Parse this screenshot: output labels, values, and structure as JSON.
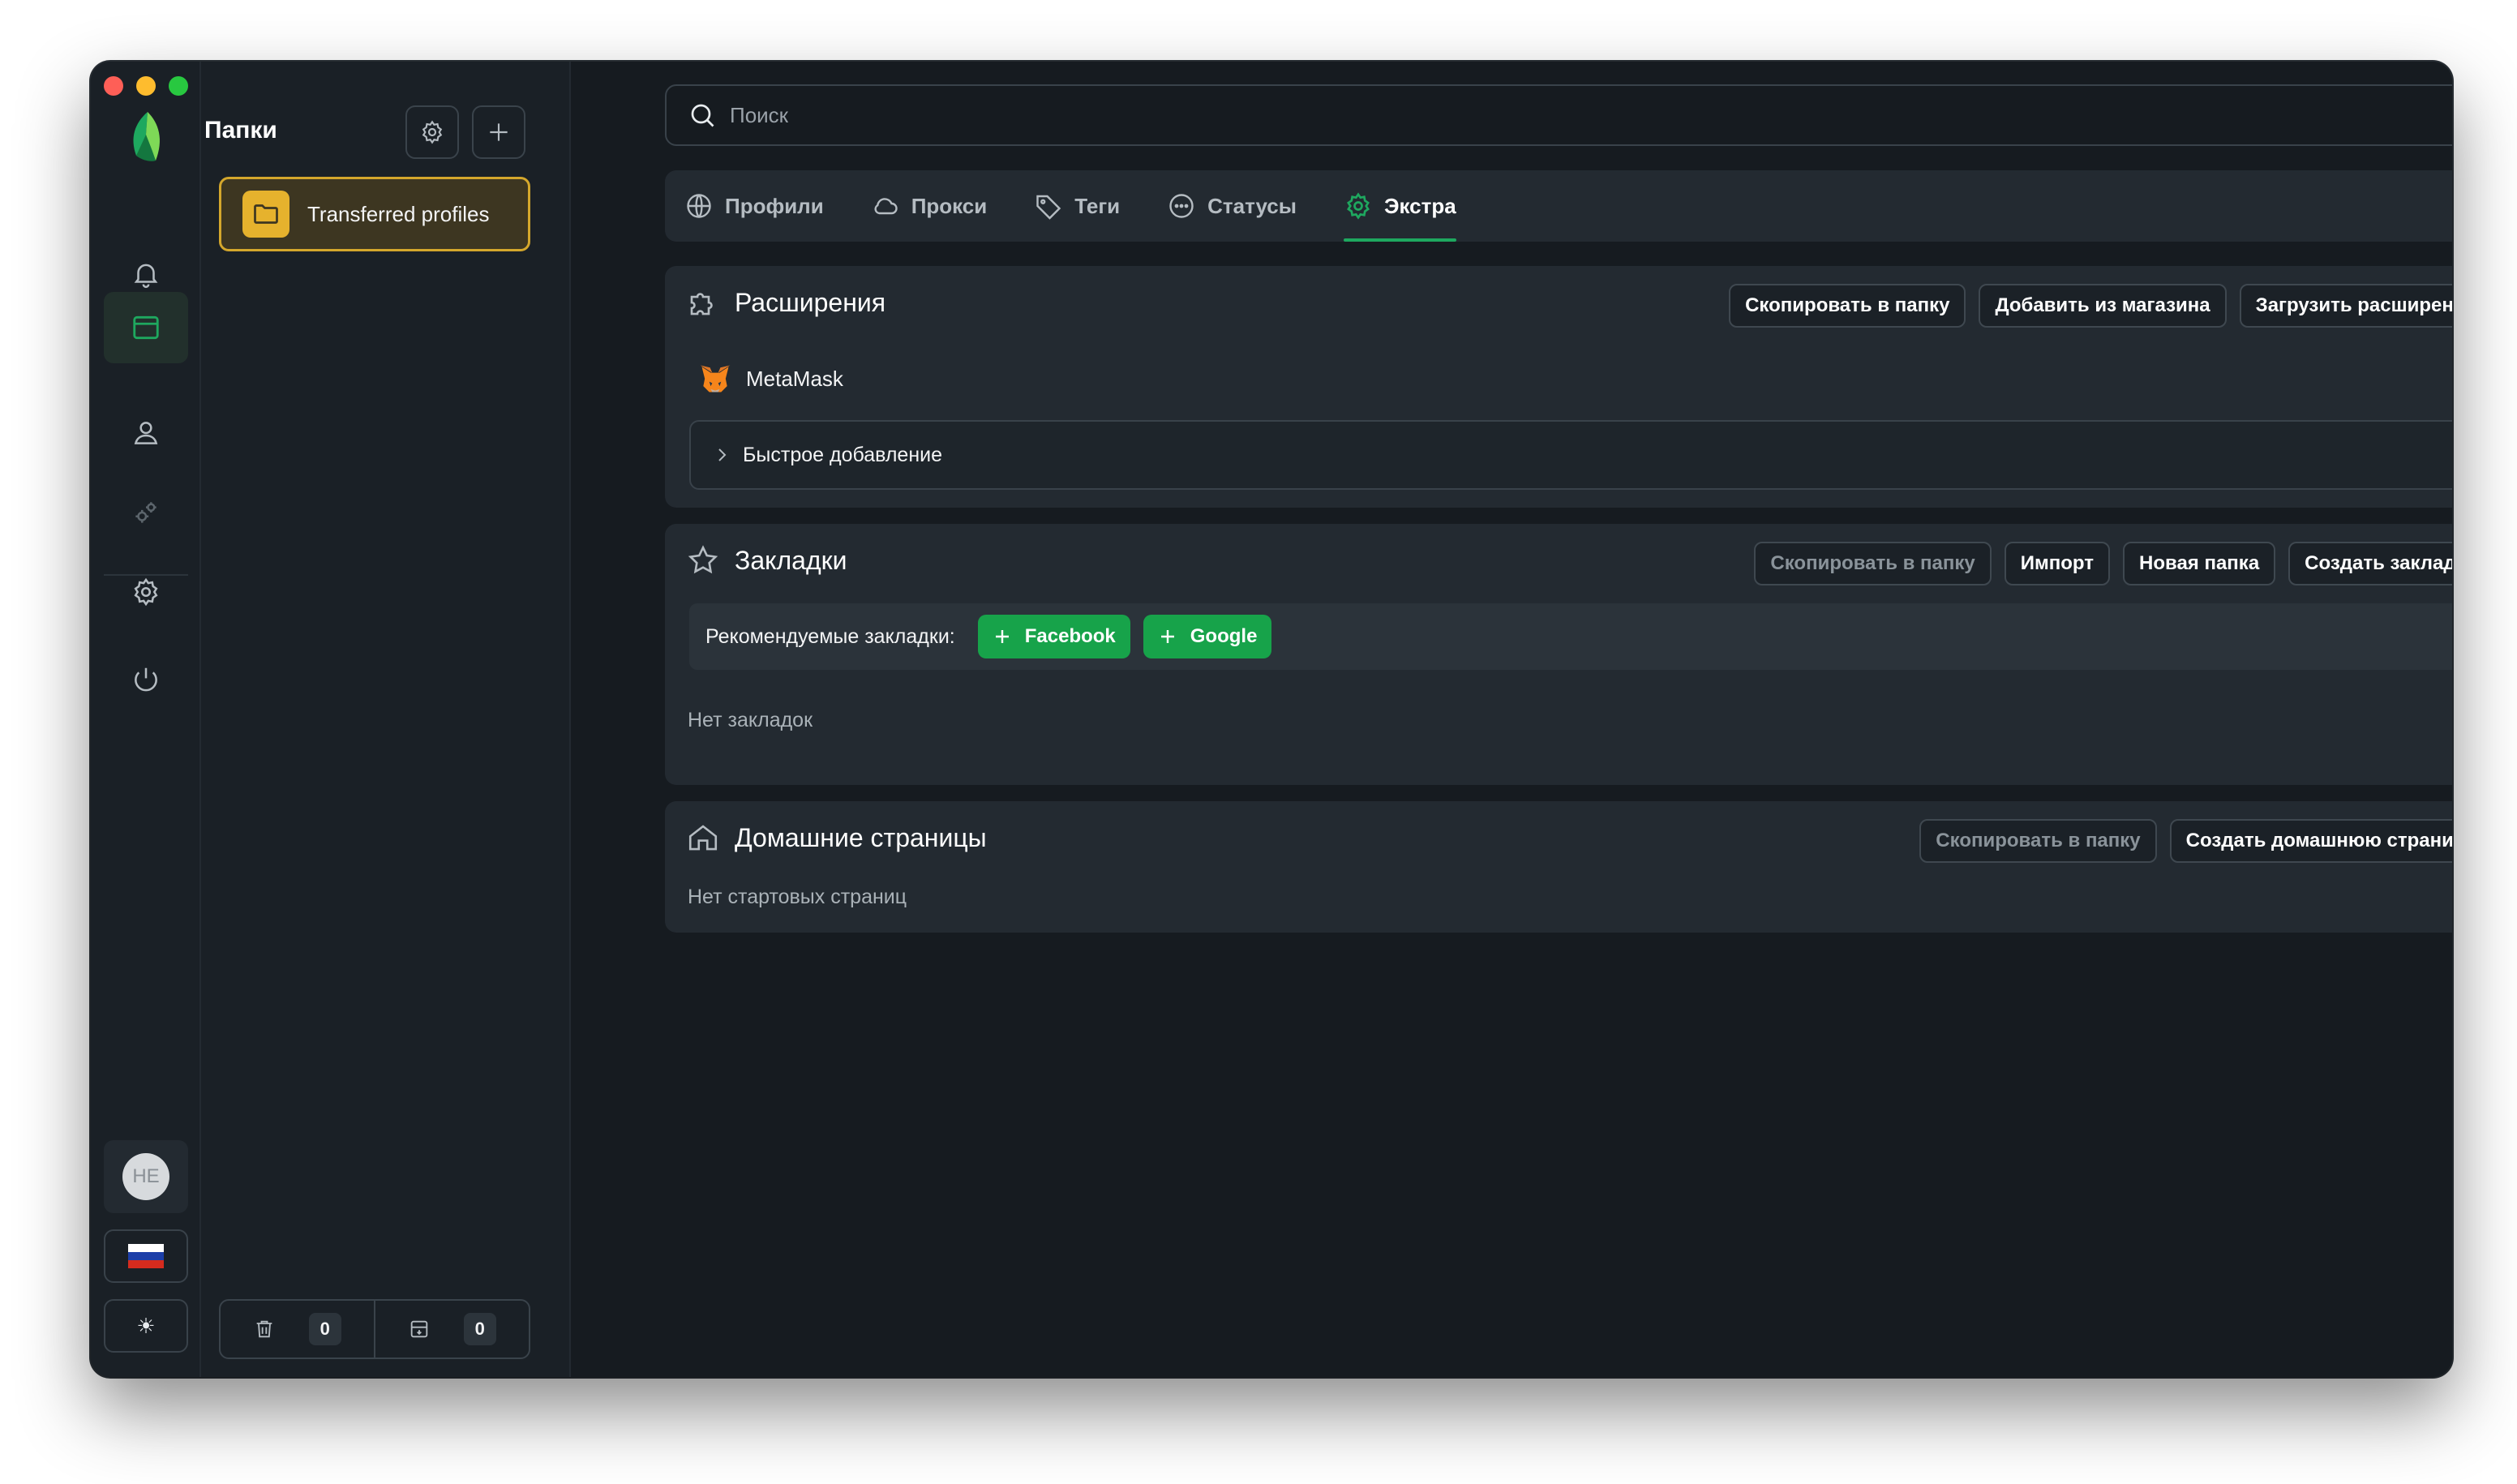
{
  "sidebar": {
    "avatar_initials": "НЕ",
    "theme_icon": "sun-icon",
    "flag_colors": [
      "#ffffff",
      "#1c3ea8",
      "#d52b1e"
    ]
  },
  "folders": {
    "title": "Папки",
    "items": [
      {
        "label": "Transferred profiles"
      }
    ],
    "trash_count": "0",
    "archive_count": "0"
  },
  "search": {
    "placeholder": "Поиск"
  },
  "tabs": [
    {
      "label": "Профили",
      "icon": "globe-icon"
    },
    {
      "label": "Прокси",
      "icon": "cloud-icon"
    },
    {
      "label": "Теги",
      "icon": "tag-icon"
    },
    {
      "label": "Статусы",
      "icon": "ellipsis-circle-icon"
    },
    {
      "label": "Экстра",
      "icon": "gear-icon",
      "active": true
    }
  ],
  "extensions": {
    "title": "Расширения",
    "actions": [
      "Скопировать в папку",
      "Добавить из магазина",
      "Загрузить расширение"
    ],
    "items": [
      {
        "name": "MetaMask",
        "toggle": "–"
      }
    ],
    "quick_add": "Быстрое добавление"
  },
  "bookmarks": {
    "title": "Закладки",
    "actions": [
      "Скопировать в папку",
      "Импорт",
      "Новая папка",
      "Создать закладку"
    ],
    "recommended_label": "Рекомендуемые закладки:",
    "recommended": [
      "Facebook",
      "Google"
    ],
    "empty": "Нет закладок"
  },
  "homepages": {
    "title": "Домашние страницы",
    "actions": [
      "Скопировать в папку",
      "Создать домашнюю страницу"
    ],
    "empty": "Нет стартовых страниц"
  },
  "colors": {
    "accent": "#1ea85f",
    "folder_border": "#d4a72c",
    "green_button": "#17a34a"
  }
}
